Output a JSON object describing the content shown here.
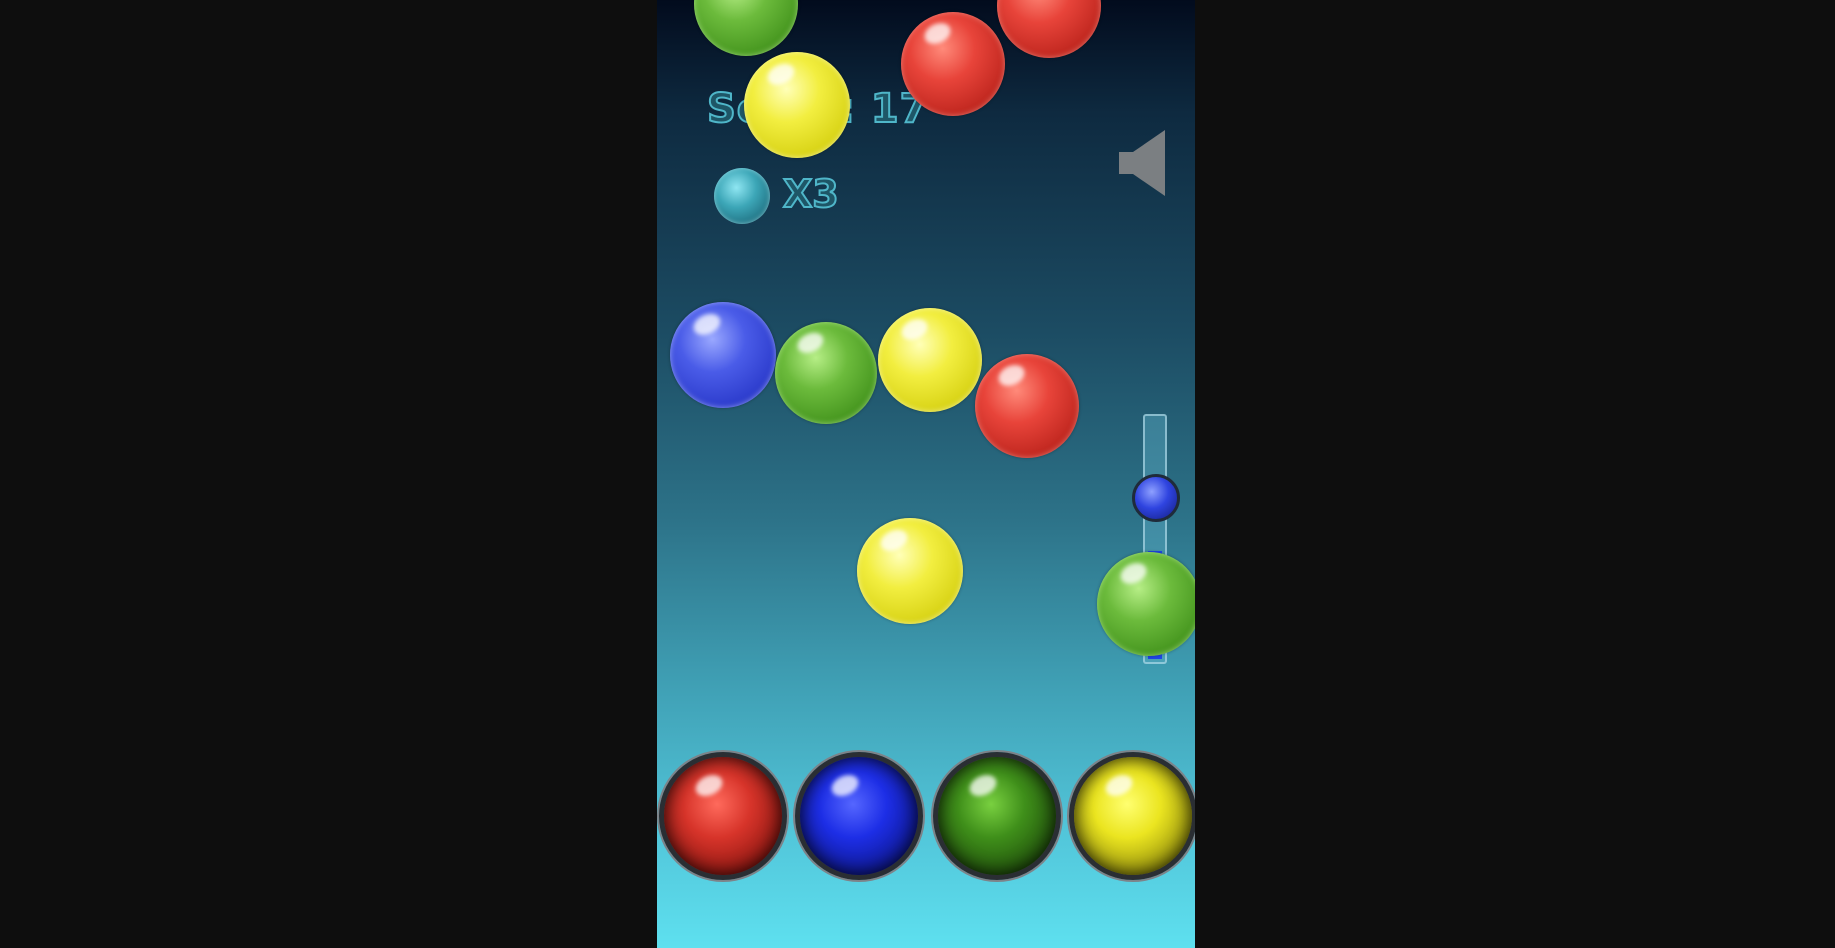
{
  "hud": {
    "score_text": "Score: 17",
    "lives_text": "X3"
  },
  "icons": {
    "sound": "speaker-icon",
    "lives": "bubble-icon"
  },
  "slider": {
    "fill_fraction": 0.45
  },
  "color_buttons": [
    {
      "name": "red",
      "color": "#d7342a"
    },
    {
      "name": "blue",
      "color": "#1d2ee6"
    },
    {
      "name": "green",
      "color": "#3f8f1a"
    },
    {
      "name": "yellow",
      "color": "#ebe520"
    }
  ],
  "bubbles": [
    {
      "color": "green"
    },
    {
      "color": "red"
    },
    {
      "color": "red"
    },
    {
      "color": "yellow"
    },
    {
      "color": "blue"
    },
    {
      "color": "green"
    },
    {
      "color": "yellow"
    },
    {
      "color": "red"
    },
    {
      "color": "yellow"
    },
    {
      "color": "green"
    }
  ]
}
